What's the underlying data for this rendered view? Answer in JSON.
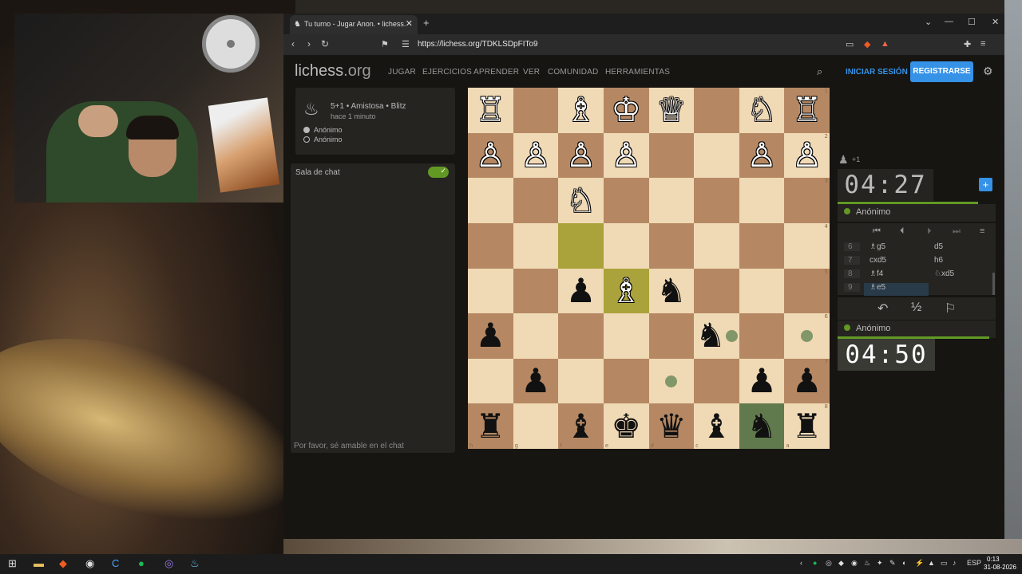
{
  "browser": {
    "tab_title": "Tu turno - Jugar Anon. • lichess.",
    "url": "https://lichess.org/TDKLSDpFITo9"
  },
  "header": {
    "logo_main": "lichess",
    "logo_org": ".org",
    "nav": [
      "JUGAR",
      "EJERCICIOS",
      "APRENDER",
      "VER",
      "COMUNIDAD",
      "HERRAMIENTAS"
    ],
    "signin": "INICIAR SESIÓN",
    "register": "REGISTRARSE"
  },
  "game_info": {
    "title": "5+1 • Amistosa • Blitz",
    "time_ago": "hace 1 minuto",
    "white_player": "Anónimo",
    "black_player": "Anónimo"
  },
  "chat": {
    "title": "Sala de chat",
    "placeholder": "Por favor, sé amable en el chat"
  },
  "board": {
    "orientation": "black",
    "rows": [
      [
        "♖",
        "",
        "♗",
        "♔",
        "♕",
        "",
        "♘",
        "♖"
      ],
      [
        "♙",
        "♙",
        "♙",
        "♙",
        "",
        "",
        "♙",
        "♙"
      ],
      [
        "",
        "",
        "♘",
        "",
        "",
        "",
        "",
        ""
      ],
      [
        "",
        "",
        "",
        "",
        "",
        "",
        "",
        ""
      ],
      [
        "",
        "",
        "♟",
        "♗",
        "♞",
        "",
        "",
        ""
      ],
      [
        "♟",
        "",
        "",
        "",
        "",
        "♞",
        "",
        ""
      ],
      [
        "",
        "♟",
        "",
        "",
        "",
        "",
        "♟",
        "♟"
      ],
      [
        "♜",
        "",
        "♝",
        "♚",
        "♛",
        "♝",
        "♞",
        "♜"
      ]
    ],
    "piece_colors": [
      [
        "w",
        "",
        "w",
        "w",
        "w",
        "",
        "w",
        "w"
      ],
      [
        "w",
        "w",
        "w",
        "w",
        "",
        "",
        "w",
        "w"
      ],
      [
        "",
        "",
        "w",
        "",
        "",
        "",
        "",
        ""
      ],
      [
        "",
        "",
        "",
        "",
        "",
        "",
        "",
        ""
      ],
      [
        "",
        "",
        "b",
        "w",
        "b",
        "",
        "",
        ""
      ],
      [
        "b",
        "",
        "",
        "",
        "",
        "b",
        "",
        ""
      ],
      [
        "",
        "b",
        "",
        "",
        "",
        "",
        "b",
        "b"
      ],
      [
        "b",
        "",
        "b",
        "b",
        "b",
        "b",
        "b",
        "b"
      ]
    ],
    "highlight_last_move": [
      [
        3,
        2
      ],
      [
        4,
        3
      ]
    ],
    "highlight_selected": [
      [
        7,
        6
      ]
    ],
    "move_dots": [
      [
        5,
        5
      ],
      [
        5,
        7
      ],
      [
        6,
        4
      ]
    ],
    "rank_labels": [
      "1",
      "2",
      "3",
      "4",
      "5",
      "6",
      "7",
      "8"
    ],
    "file_labels": [
      "h",
      "g",
      "f",
      "e",
      "d",
      "c",
      "b",
      "a"
    ]
  },
  "clocks": {
    "opponent": "04:27",
    "player": "04:50",
    "material_diff": "+1"
  },
  "players": {
    "top": "Anónimo",
    "bottom": "Anónimo"
  },
  "moves": [
    {
      "num": "6",
      "white": "♗g5",
      "black": "d5"
    },
    {
      "num": "7",
      "white": "cxd5",
      "black": "h6"
    },
    {
      "num": "8",
      "white": "♗f4",
      "black": "♘xd5"
    },
    {
      "num": "9",
      "white": "♗e5",
      "black": ""
    }
  ],
  "taskbar": {
    "lang": "ESP",
    "time": "0:13",
    "date": "31-08-2026"
  }
}
